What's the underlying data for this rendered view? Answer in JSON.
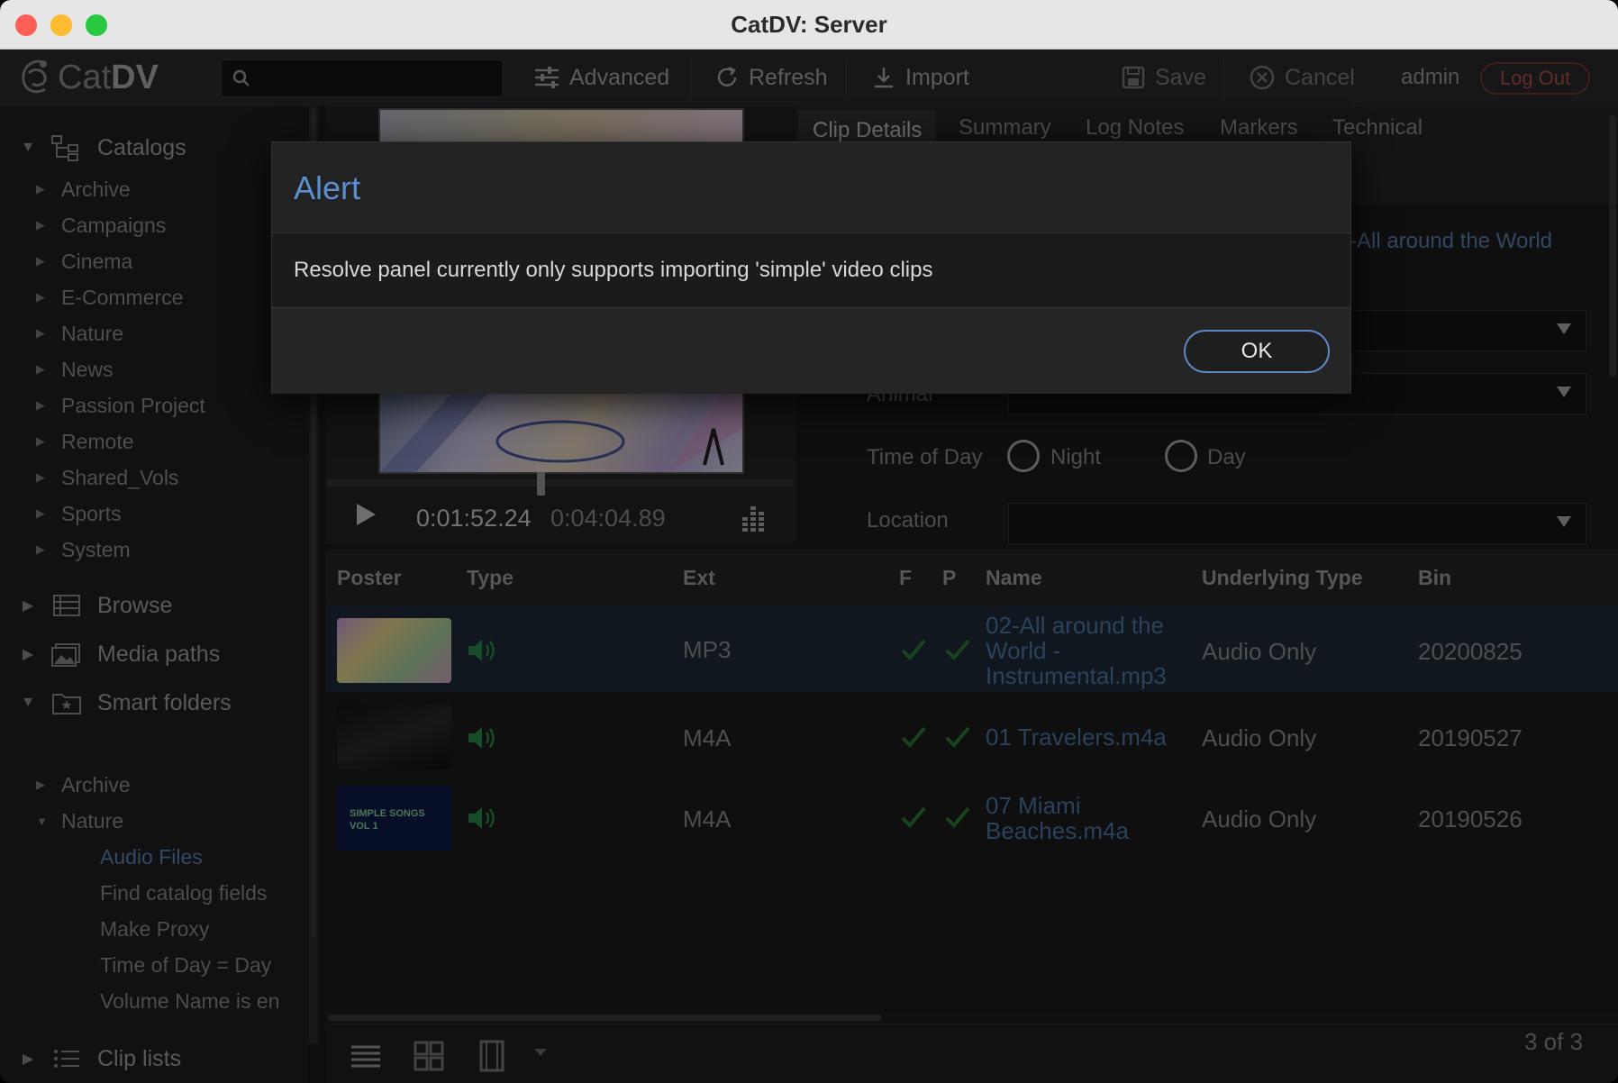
{
  "window": {
    "title": "CatDV: Server"
  },
  "toolbar": {
    "logo_text_a": "Cat",
    "logo_text_b": "DV",
    "search_placeholder": "",
    "advanced_label": "Advanced",
    "refresh_label": "Refresh",
    "import_label": "Import",
    "save_label": "Save",
    "cancel_label": "Cancel",
    "user": "admin",
    "logout_label": "Log Out"
  },
  "sidebar": {
    "catalogs_label": "Catalogs",
    "catalogs": [
      "Archive",
      "Campaigns",
      "Cinema",
      "E-Commerce",
      "Nature",
      "News",
      "Passion Project",
      "Remote",
      "Shared_Vols",
      "Sports",
      "System"
    ],
    "browse_label": "Browse",
    "media_paths_label": "Media paths",
    "smart_folders_label": "Smart folders",
    "smart_archive": "Archive",
    "smart_nature": "Nature",
    "nature_children": [
      "Audio Files",
      "Find catalog fields",
      "Make Proxy",
      "Time of Day = Day",
      "Volume Name is en"
    ],
    "clip_lists_label": "Clip lists"
  },
  "player": {
    "current_time": "0:01:52.24",
    "duration": "0:04:04.89"
  },
  "details": {
    "tabs": [
      "Clip Details",
      "Summary",
      "Log Notes",
      "Markers",
      "Technical"
    ],
    "clip_name_partial": "-All around the World",
    "animal_label": "Animal",
    "time_of_day_label": "Time of Day",
    "night_label": "Night",
    "day_label": "Day",
    "location_label": "Location"
  },
  "table": {
    "columns": [
      "Poster",
      "Type",
      "Ext",
      "F",
      "P",
      "Name",
      "Underlying Type",
      "Bin"
    ],
    "rows": [
      {
        "ext": "MP3",
        "name_l1": "02-All around the",
        "name_l2": "World -",
        "name_l3": "Instrumental.mp3",
        "underlying": "Audio Only",
        "bin": "20200825",
        "poster_text": ""
      },
      {
        "ext": "M4A",
        "name_l1": "01 Travelers.m4a",
        "underlying": "Audio Only",
        "bin": "20190527",
        "poster_text": ""
      },
      {
        "ext": "M4A",
        "name_l1": "07 Miami",
        "name_l2": "Beaches.m4a",
        "underlying": "Audio Only",
        "bin": "20190526",
        "poster_text": "SIMPLE SONGS VOL 1"
      }
    ],
    "count": "3 of 3"
  },
  "dialog": {
    "title": "Alert",
    "message": "Resolve panel currently only supports importing 'simple' video clips",
    "ok_label": "OK"
  },
  "colors": {
    "accent": "#5b8fd0",
    "link": "#4f78a8",
    "check": "#3a8a3a",
    "logout": "#b05048"
  }
}
